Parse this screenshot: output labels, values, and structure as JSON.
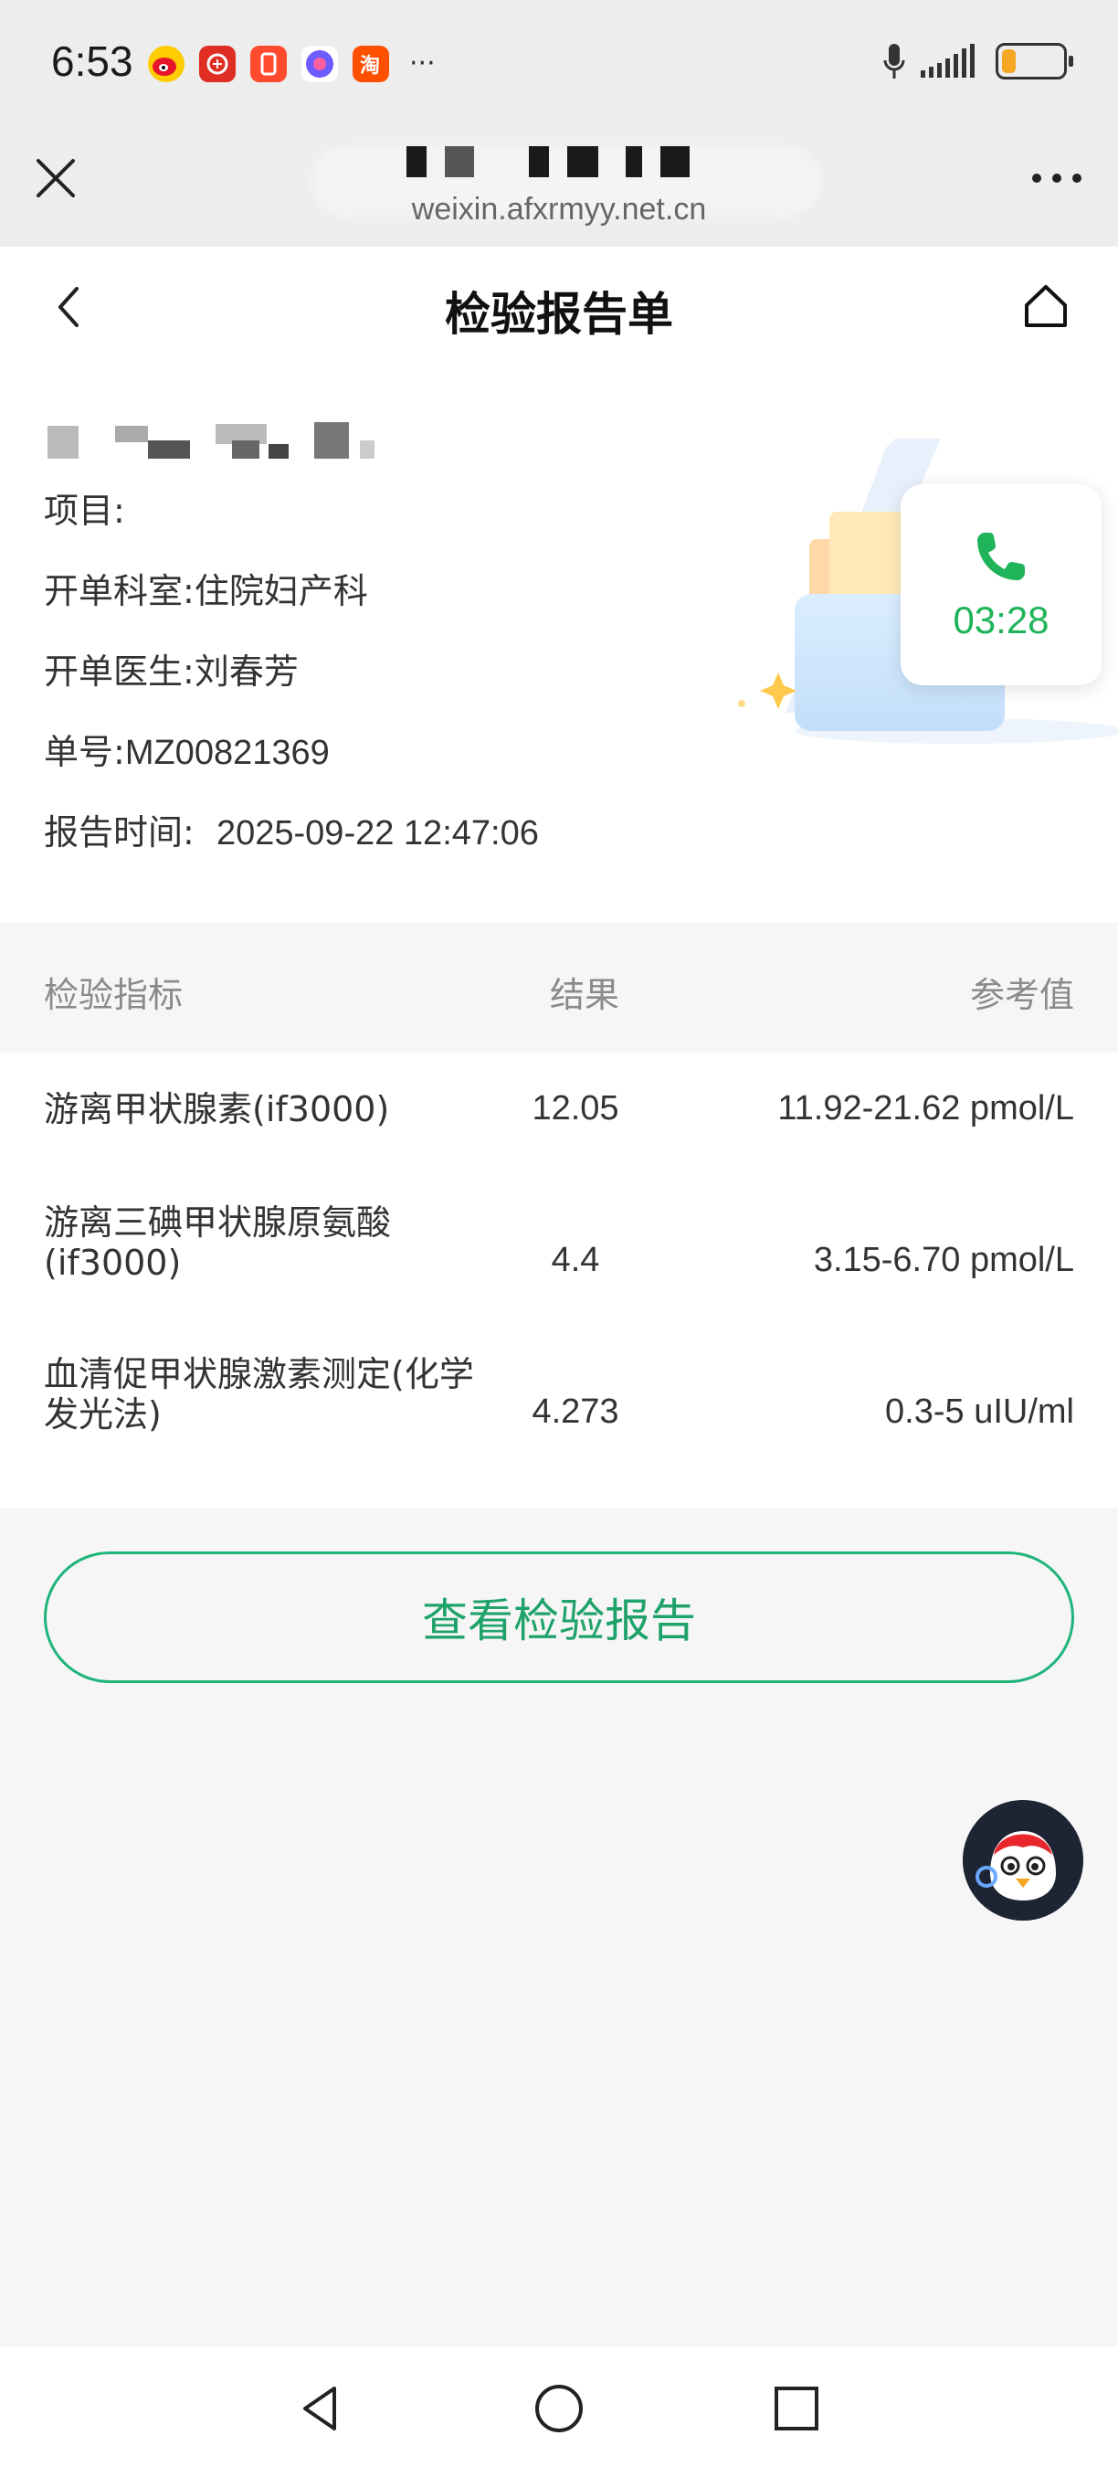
{
  "status_bar": {
    "time": "6:53",
    "more": "···"
  },
  "browser": {
    "url": "weixin.afxrmyy.net.cn"
  },
  "header": {
    "title": "检验报告单"
  },
  "info": {
    "project_label": "项目:",
    "project_value": "",
    "dept_label": "开单科室:",
    "dept_value": "住院妇产科",
    "doctor_label": "开单医生:",
    "doctor_value": "刘春芳",
    "order_label": "单号:",
    "order_value": "MZ00821369",
    "time_label": "报告时间:",
    "time_value": "2025-09-22 12:47:06"
  },
  "call": {
    "duration": "03:28"
  },
  "table": {
    "headers": {
      "name": "检验指标",
      "result": "结果",
      "reference": "参考值"
    },
    "rows": [
      {
        "name": "游离甲状腺素(if3000)",
        "result": "12.05",
        "reference": "11.92-21.62 pmol/L"
      },
      {
        "name": "游离三碘甲状腺原氨酸(if3000)",
        "result": "4.4",
        "reference": "3.15-6.70 pmol/L"
      },
      {
        "name": "血清促甲状腺激素测定(化学发光法)",
        "result": "4.273",
        "reference": "0.3-5 uIU/ml"
      }
    ]
  },
  "actions": {
    "view_report": "查看检验报告"
  },
  "colors": {
    "accent": "#1fb47a",
    "call_green": "#1fb45a",
    "battery": "#f5a623"
  }
}
